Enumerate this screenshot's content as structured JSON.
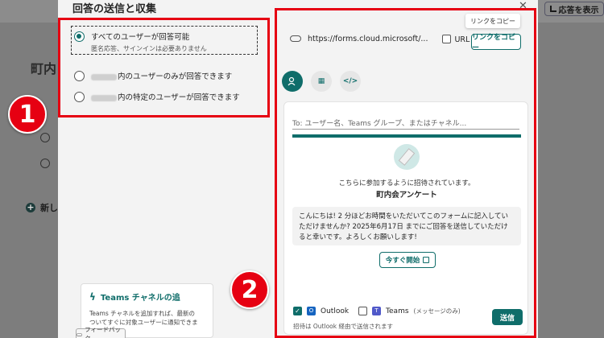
{
  "background": {
    "title": "町内",
    "add_label": "新し",
    "view_responses_button": "応答を表示"
  },
  "dialog": {
    "title": "回答の送信と収集",
    "options": [
      {
        "label": "すべてのユーザーが回答可能",
        "sub": "匿名応答、サインインは必要ありません",
        "selected": true
      },
      {
        "label": "内のユーザーのみが回答できます",
        "sub": "",
        "selected": false
      },
      {
        "label": "内の特定のユーザーが回答できます",
        "sub": "",
        "selected": false
      }
    ],
    "teams_card": {
      "title": "Teams チャネルの追",
      "desc_line1": "Teams チャネルを追加すれば、最新の",
      "desc_line2": "ついてすぐに対象ユーザーに通知できます。"
    },
    "feedback_label": "フィードバック"
  },
  "share": {
    "tooltip": "リンクをコピー",
    "url": "https://forms.cloud.microsoft/...",
    "shorten_label": "URL を短縮",
    "copy_button": "リンクをコピー",
    "tab_icons": [
      "person-share-icon",
      "qr-code-icon",
      "embed-code-icon"
    ],
    "tab_labels": [
      "",
      "▦",
      "</>"
    ]
  },
  "mail": {
    "to_placeholder": "To: ユーザー名、Teams グループ、またはチャネル...",
    "invite_text": "こちらに参加するように招待されています。",
    "form_name": "町内会アンケート",
    "message": "こんにちは! 2 分ほどお時間をいただいてこのフォームに記入していただけませんか? 2025年6月17日 までにご回答を送信していただけると幸いです。よろしくお願いします!",
    "start_button": "今すぐ開始",
    "outlook_label": "Outlook",
    "teams_label": "Teams",
    "teams_note": "(メッセージのみ)",
    "footer_note": "招待は Outlook 経由で送信されます",
    "send_button": "送信"
  },
  "annotations": {
    "badge1": "1",
    "badge2": "2"
  },
  "colors": {
    "accent": "#0f6d6a",
    "annotation_red": "#e60012"
  }
}
